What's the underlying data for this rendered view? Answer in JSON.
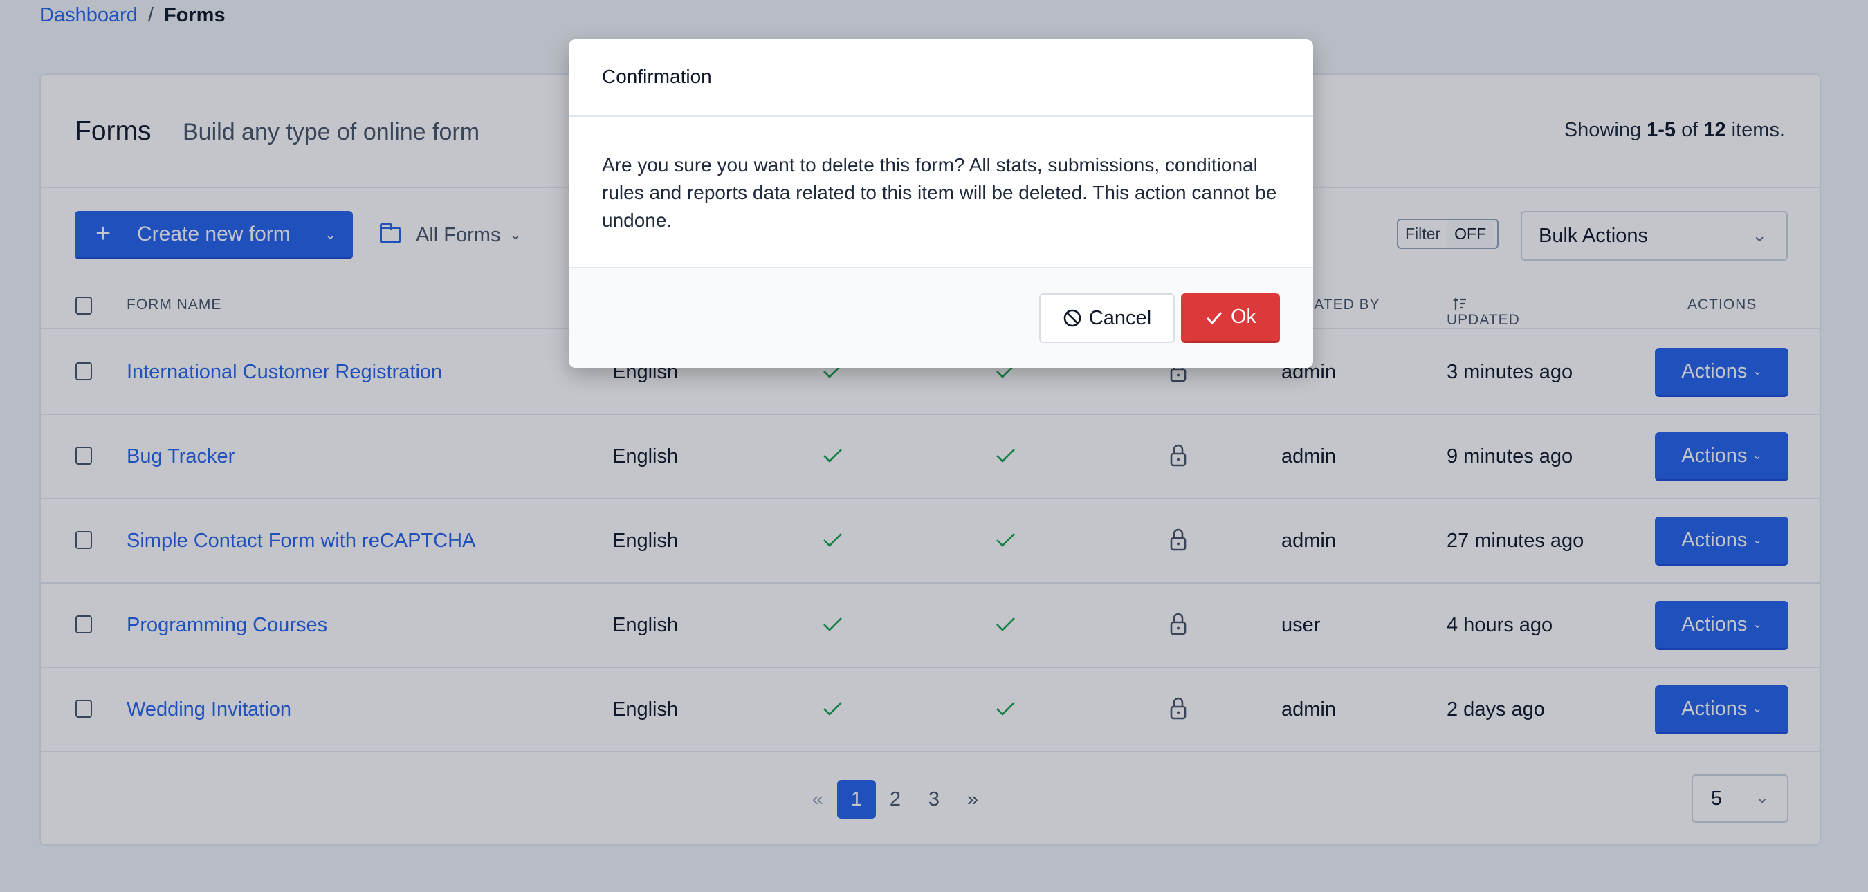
{
  "breadcrumb": {
    "parent": "Dashboard",
    "separator": "/",
    "current": "Forms"
  },
  "header": {
    "title": "Forms",
    "subtitle": "Build any type of online form",
    "showing_prefix": "Showing ",
    "showing_range": "1-5",
    "showing_of": " of ",
    "showing_total": "12",
    "showing_suffix": " items."
  },
  "toolbar": {
    "create_label": "Create new form",
    "create_icon": "plus-icon",
    "folder_label": "All Forms",
    "folder_icon": "folder-icon",
    "filter_label": "Filter",
    "filter_state": "OFF",
    "bulk_actions": "Bulk Actions"
  },
  "table": {
    "columns": [
      "FORM NAME",
      "CREATED BY",
      "UPDATED",
      "ACTIONS"
    ],
    "sort_icon": "sort-descending-icon",
    "rows": [
      {
        "name": "International Customer Registration",
        "language": "English",
        "check1": true,
        "check2": true,
        "locked": true,
        "created_by": "admin",
        "updated": "3 minutes ago",
        "action": "Actions"
      },
      {
        "name": "Bug Tracker",
        "language": "English",
        "check1": true,
        "check2": true,
        "locked": true,
        "created_by": "admin",
        "updated": "9 minutes ago",
        "action": "Actions"
      },
      {
        "name": "Simple Contact Form with reCAPTCHA",
        "language": "English",
        "check1": true,
        "check2": true,
        "locked": true,
        "created_by": "admin",
        "updated": "27 minutes ago",
        "action": "Actions"
      },
      {
        "name": "Programming Courses",
        "language": "English",
        "check1": true,
        "check2": true,
        "locked": true,
        "created_by": "user",
        "updated": "4 hours ago",
        "action": "Actions"
      },
      {
        "name": "Wedding Invitation",
        "language": "English",
        "check1": true,
        "check2": true,
        "locked": true,
        "created_by": "admin",
        "updated": "2 days ago",
        "action": "Actions"
      }
    ]
  },
  "pagination": {
    "prev": "«",
    "pages": [
      "1",
      "2",
      "3"
    ],
    "current": "1",
    "next": "»",
    "per_page": "5"
  },
  "modal": {
    "title": "Confirmation",
    "message": "Are you sure you want to delete this form? All stats, submissions, conditional rules and reports data related to this item will be deleted. This action cannot be undone.",
    "cancel_label": "Cancel",
    "ok_label": "Ok"
  },
  "colors": {
    "primary": "#2563eb",
    "danger": "#dc3a3a",
    "success": "#16a34a",
    "background": "#f1f5f9"
  }
}
